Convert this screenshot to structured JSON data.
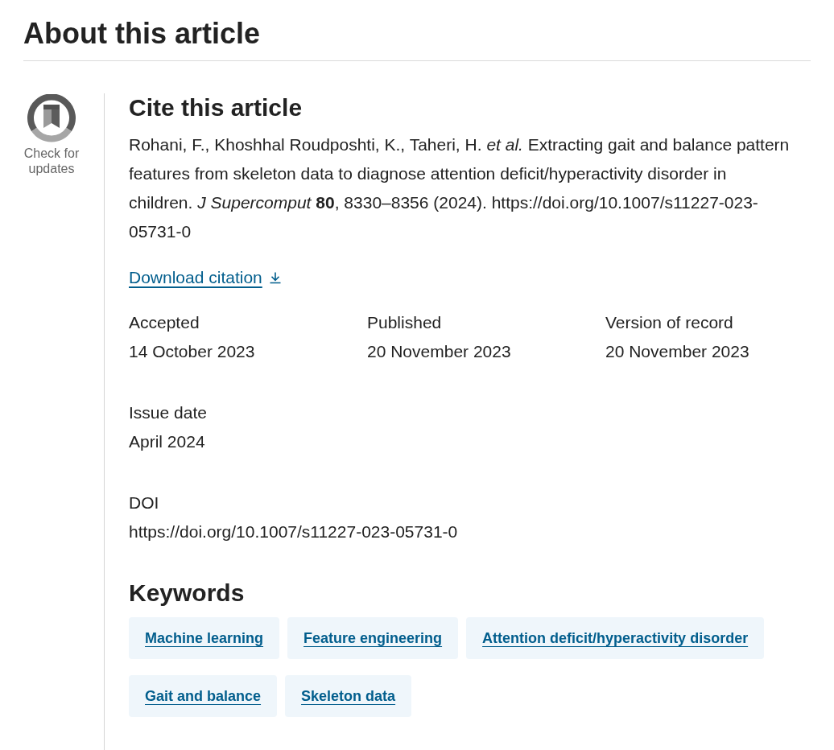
{
  "heading": "About this article",
  "check_for_updates": {
    "label": "Check for updates"
  },
  "cite": {
    "heading": "Cite this article",
    "citation": "Rohani, F., Khoshhal Roudposhti, K., Taheri, H. *et al.* Extracting gait and balance pattern features from skeleton data to diagnose attention deficit/hyperactivity disorder in children. *J Supercomput* **80**, 8330–8356 (2024). https://doi.org/10.1007/s11227-023-05731-0",
    "download_link": "Download citation"
  },
  "bibliographic_info": [
    {
      "kind": "date",
      "label": "Accepted",
      "value": "14 October 2023"
    },
    {
      "kind": "date",
      "label": "Published",
      "value": "20 November 2023"
    },
    {
      "kind": "date",
      "label": "Version of record",
      "value": "20 November 2023"
    },
    {
      "kind": "date",
      "label": "Issue date",
      "value": "April 2024"
    },
    {
      "kind": "doi",
      "label": "DOI",
      "value": "https://doi.org/10.1007/s11227-023-05731-0"
    }
  ],
  "keywords": {
    "heading": "Keywords",
    "items": [
      "Machine learning",
      "Feature engineering",
      "Attention deficit/hyperactivity disorder",
      "Gait and balance",
      "Skeleton data"
    ]
  }
}
